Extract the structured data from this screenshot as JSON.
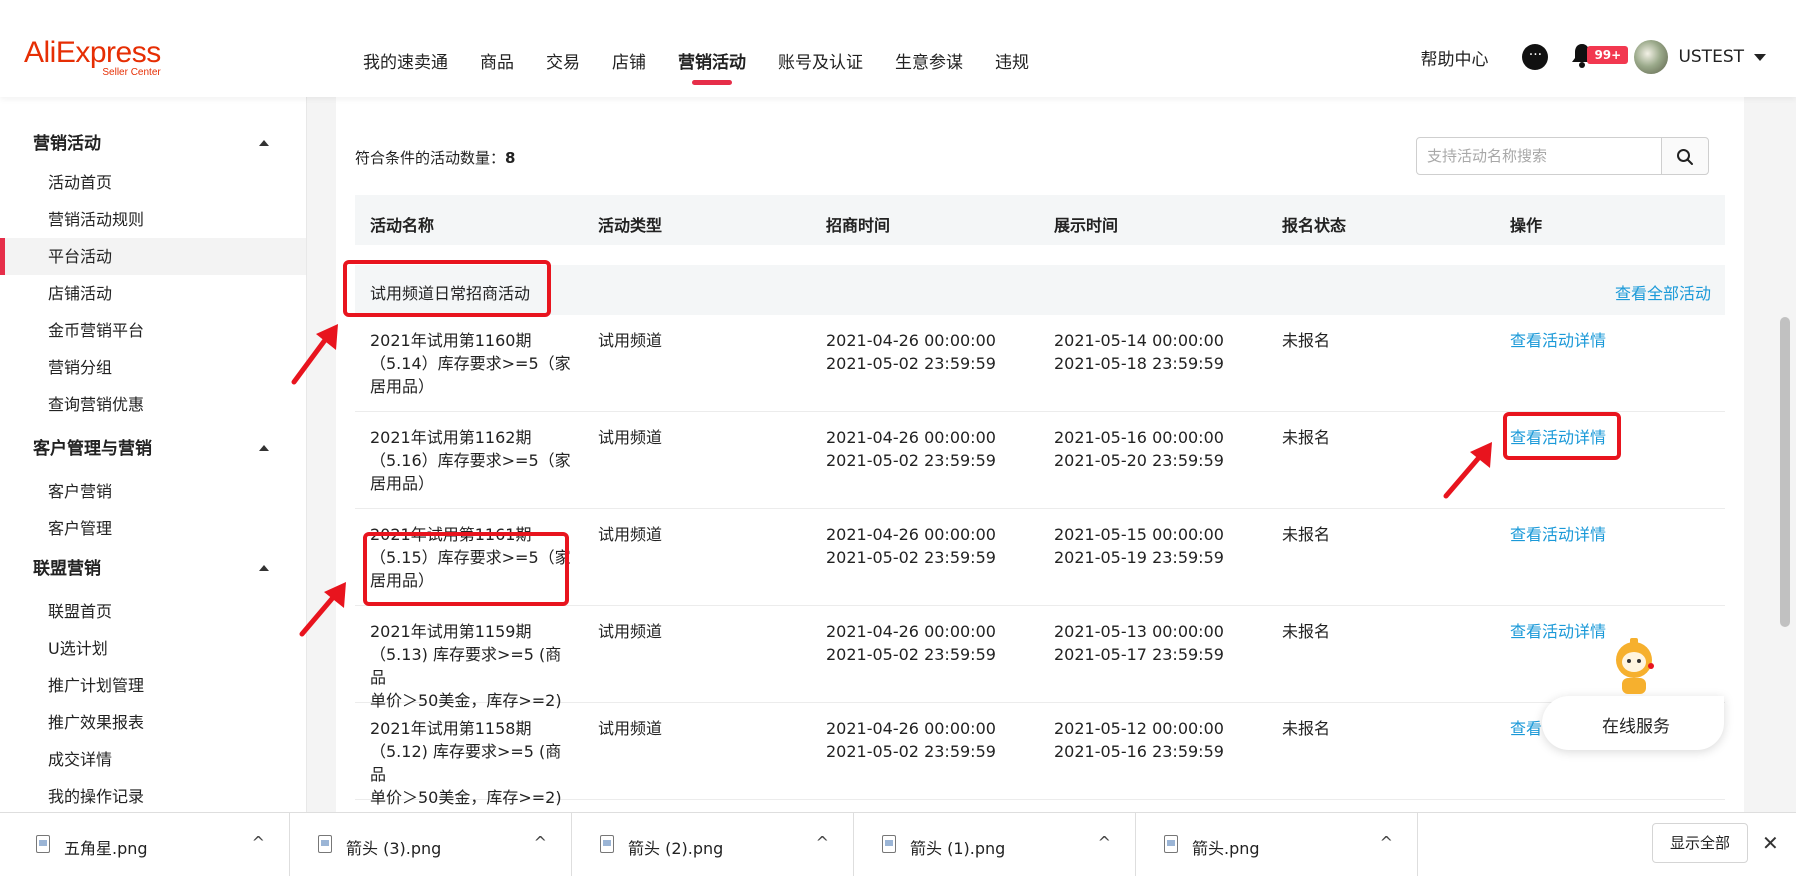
{
  "logo": {
    "main": "AliExpress",
    "sub": "Seller Center"
  },
  "nav": [
    "我的速卖通",
    "商品",
    "交易",
    "店铺",
    "营销活动",
    "账号及认证",
    "生意参谋",
    "违规"
  ],
  "header": {
    "help": "帮助中心",
    "notification_badge": "99+",
    "username": "USTEST"
  },
  "sidebar": {
    "groups": [
      {
        "title": "营销活动",
        "items": [
          "活动首页",
          "营销活动规则",
          "平台活动",
          "店铺活动",
          "金币营销平台",
          "营销分组",
          "查询营销优惠"
        ]
      },
      {
        "title": "客户管理与营销",
        "items": [
          "客户营销",
          "客户管理"
        ]
      },
      {
        "title": "联盟营销",
        "items": [
          "联盟首页",
          "U选计划",
          "推广计划管理",
          "推广效果报表",
          "成交详情",
          "我的操作记录"
        ]
      }
    ]
  },
  "main": {
    "count_label": "符合条件的活动数量：",
    "count_value": "8",
    "search_placeholder": "支持活动名称搜索",
    "columns": [
      "活动名称",
      "活动类型",
      "招商时间",
      "展示时间",
      "报名状态",
      "操作"
    ],
    "group_name": "试用频道日常招商活动",
    "view_all": "查看全部活动",
    "rows": [
      {
        "name_l1": "2021年试用第1160期",
        "name_l2": "（5.14）库存要求>=5（家",
        "name_l3": "居用品）",
        "type": "试用频道",
        "recruit_start": "2021-04-26 00:00:00",
        "recruit_end": "2021-05-02 23:59:59",
        "show_start": "2021-05-14 00:00:00",
        "show_end": "2021-05-18 23:59:59",
        "status": "未报名",
        "action": "查看活动详情"
      },
      {
        "name_l1": "2021年试用第1162期",
        "name_l2": "（5.16）库存要求>=5（家",
        "name_l3": "居用品）",
        "type": "试用频道",
        "recruit_start": "2021-04-26 00:00:00",
        "recruit_end": "2021-05-02 23:59:59",
        "show_start": "2021-05-16 00:00:00",
        "show_end": "2021-05-20 23:59:59",
        "status": "未报名",
        "action": "查看活动详情"
      },
      {
        "name_l1": "2021年试用第1161期",
        "name_l2": "（5.15）库存要求>=5（家",
        "name_l3": "居用品）",
        "type": "试用频道",
        "recruit_start": "2021-04-26 00:00:00",
        "recruit_end": "2021-05-02 23:59:59",
        "show_start": "2021-05-15 00:00:00",
        "show_end": "2021-05-19 23:59:59",
        "status": "未报名",
        "action": "查看活动详情"
      },
      {
        "name_l1": "2021年试用第1159期",
        "name_l2": "（5.13) 库存要求>=5 (商品",
        "name_l3": "单价＞50美金，库存>=2)",
        "type": "试用频道",
        "recruit_start": "2021-04-26 00:00:00",
        "recruit_end": "2021-05-02 23:59:59",
        "show_start": "2021-05-13 00:00:00",
        "show_end": "2021-05-17 23:59:59",
        "status": "未报名",
        "action": "查看活动详情"
      },
      {
        "name_l1": "2021年试用第1158期",
        "name_l2": "（5.12) 库存要求>=5 (商品",
        "name_l3": "单价＞50美金，库存>=2)",
        "type": "试用频道",
        "recruit_start": "2021-04-26 00:00:00",
        "recruit_end": "2021-05-02 23:59:59",
        "show_start": "2021-05-12 00:00:00",
        "show_end": "2021-05-16 23:59:59",
        "status": "未报名",
        "action": "查看"
      }
    ]
  },
  "service": {
    "label": "在线服务"
  },
  "downloads": {
    "files": [
      "五角星.png",
      "箭头 (3).png",
      "箭头 (2).png",
      "箭头 (1).png",
      "箭头.png"
    ],
    "show_all": "显示全部"
  },
  "colors": {
    "brand": "#e62e04",
    "accent": "#e62e49",
    "link": "#1a99d8",
    "annotation": "#e8141e"
  }
}
